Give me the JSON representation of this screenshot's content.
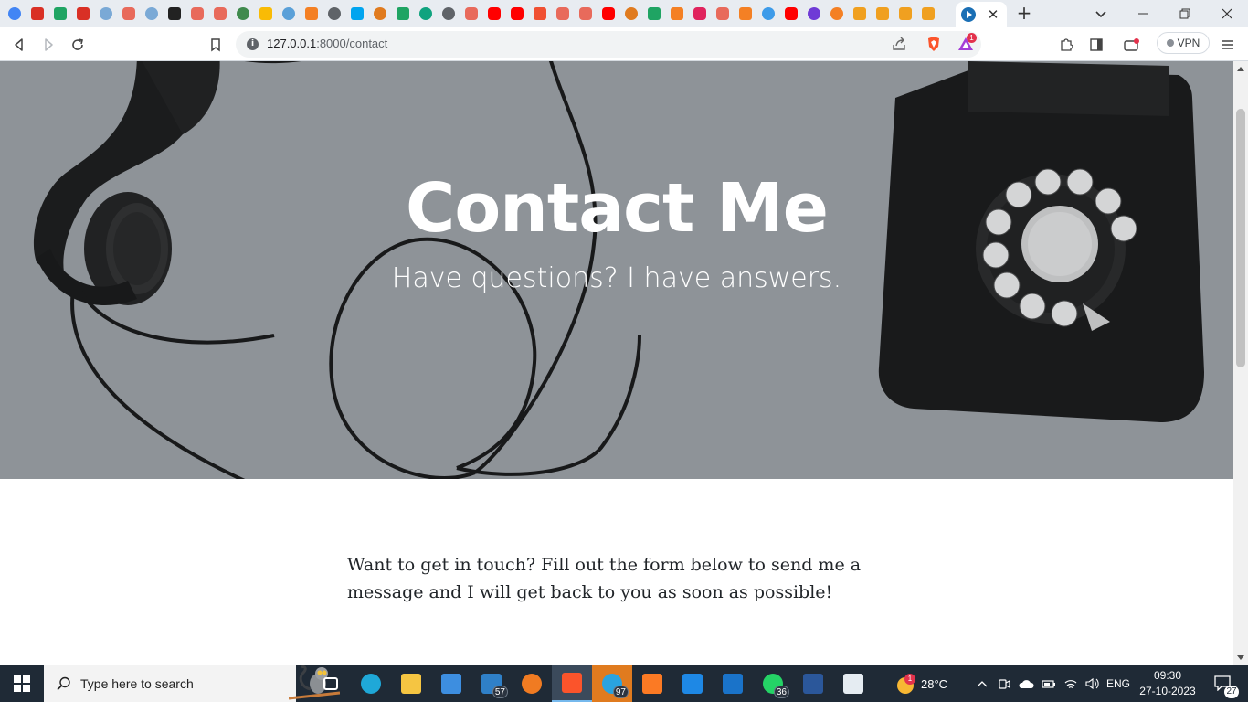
{
  "browser": {
    "tabs": {
      "pinned_favicons": [
        {
          "icon": "google-icon",
          "color": "#4285f4"
        },
        {
          "icon": "gmail-icon",
          "color": "#d93025"
        },
        {
          "icon": "google-drive-icon",
          "color": "#1fa463"
        },
        {
          "icon": "gmail-icon",
          "color": "#d93025"
        },
        {
          "icon": "site-icon",
          "color": "#7aa9d6"
        },
        {
          "icon": "brave-shield-icon",
          "color": "#e86a5b"
        },
        {
          "icon": "site-icon",
          "color": "#7aa9d6"
        },
        {
          "icon": "j-icon",
          "color": "#222222"
        },
        {
          "icon": "brave-shield-icon",
          "color": "#e86a5b"
        },
        {
          "icon": "brave-shield-icon",
          "color": "#e86a5b"
        },
        {
          "icon": "site-icon",
          "color": "#3f8a4d"
        },
        {
          "icon": "google-classroom-icon",
          "color": "#f9bb05"
        },
        {
          "icon": "site-icon",
          "color": "#5aa0d8"
        },
        {
          "icon": "stackoverflow-icon",
          "color": "#f48024"
        },
        {
          "icon": "globe-icon",
          "color": "#5f6368"
        },
        {
          "icon": "microsoft-icon",
          "color": "#00a4ef"
        },
        {
          "icon": "site-icon",
          "color": "#e07b1f"
        },
        {
          "icon": "google-drive-icon",
          "color": "#1fa463"
        },
        {
          "icon": "chatgpt-icon",
          "color": "#10a37f"
        },
        {
          "icon": "globe-icon",
          "color": "#5f6368"
        },
        {
          "icon": "brave-shield-icon",
          "color": "#e86a5b"
        },
        {
          "icon": "youtube-icon",
          "color": "#ff0000"
        },
        {
          "icon": "youtube-icon",
          "color": "#ff0000"
        },
        {
          "icon": "git-icon",
          "color": "#f05033"
        },
        {
          "icon": "brave-shield-icon",
          "color": "#e86a5b"
        },
        {
          "icon": "brave-shield-icon",
          "color": "#e86a5b"
        },
        {
          "icon": "youtube-icon",
          "color": "#ff0000"
        },
        {
          "icon": "site-icon",
          "color": "#e07b1f"
        },
        {
          "icon": "google-drive-icon",
          "color": "#1fa463"
        },
        {
          "icon": "stackoverflow-icon",
          "color": "#f48024"
        },
        {
          "icon": "heart-icon",
          "color": "#e0245e"
        },
        {
          "icon": "brave-shield-icon",
          "color": "#e86a5b"
        },
        {
          "icon": "stackoverflow-icon",
          "color": "#f48024"
        },
        {
          "icon": "site-icon",
          "color": "#3d9be9"
        },
        {
          "icon": "youtube-icon",
          "color": "#ff0000"
        },
        {
          "icon": "site-icon",
          "color": "#6f3bd6"
        },
        {
          "icon": "site-icon",
          "color": "#f48024"
        },
        {
          "icon": "bookmark-book-icon",
          "color": "#f0a020"
        },
        {
          "icon": "bookmark-book-icon",
          "color": "#f0a020"
        },
        {
          "icon": "bookmark-book-icon",
          "color": "#f0a020"
        },
        {
          "icon": "bookmark-book-icon",
          "color": "#f0a020"
        }
      ],
      "active_tab_icon": "play-circle-icon"
    },
    "address": {
      "host": "127.0.0.1",
      "path": ":8000/contact"
    },
    "brave_notification_count": "1",
    "vpn_label": "VPN"
  },
  "page": {
    "hero": {
      "title": "Contact Me",
      "subtitle": "Have questions? I have answers."
    },
    "intro_text": "Want to get in touch? Fill out the form below to send me a message and I will get back to you as soon as possible!"
  },
  "taskbar": {
    "search_placeholder": "Type here to search",
    "apps": [
      {
        "name": "task-view-icon"
      },
      {
        "name": "edge-icon"
      },
      {
        "name": "file-explorer-icon"
      },
      {
        "name": "microsoft-store-icon"
      },
      {
        "name": "mail-icon",
        "badge": "57"
      },
      {
        "name": "firefox-icon"
      },
      {
        "name": "brave-icon"
      },
      {
        "name": "telegram-icon",
        "badge": "97"
      },
      {
        "name": "xampp-icon"
      },
      {
        "name": "vscode-icon"
      },
      {
        "name": "outlook-icon"
      },
      {
        "name": "whatsapp-icon",
        "badge": "36"
      },
      {
        "name": "word-icon"
      },
      {
        "name": "paint-icon"
      }
    ],
    "weather": {
      "temp": "28°C",
      "alert_count": "1"
    },
    "language": "ENG",
    "clock": {
      "time": "09:30",
      "date": "27-10-2023"
    },
    "notification_count": "27"
  }
}
